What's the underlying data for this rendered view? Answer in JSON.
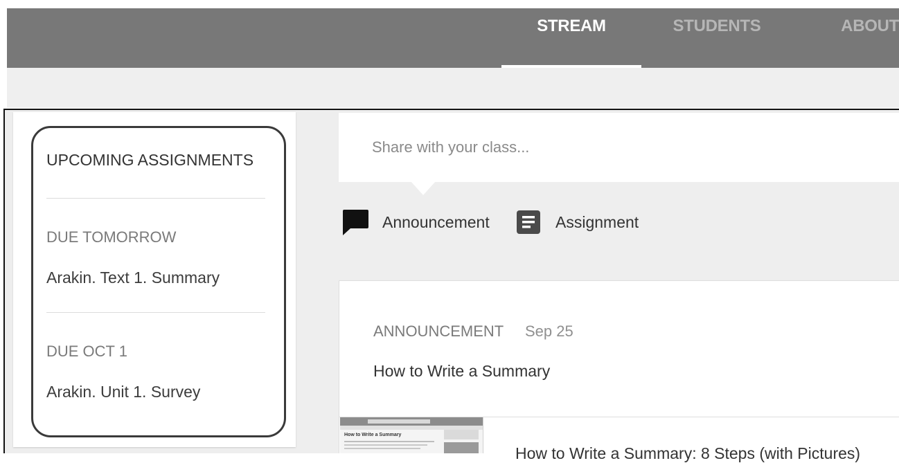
{
  "header": {
    "tabs": [
      {
        "label": "STREAM",
        "active": true
      },
      {
        "label": "STUDENTS",
        "active": false
      },
      {
        "label": "ABOUT",
        "active": false
      }
    ]
  },
  "sidebar": {
    "title": "UPCOMING ASSIGNMENTS",
    "groups": [
      {
        "due": "DUE TOMORROW",
        "item": "Arakin. Text 1. Summary"
      },
      {
        "due": "DUE OCT 1",
        "item": "Arakin. Unit 1. Survey"
      }
    ]
  },
  "composer": {
    "placeholder": "Share with your class...",
    "actions": [
      {
        "label": "Announcement",
        "icon": "chat-bubble-icon"
      },
      {
        "label": "Assignment",
        "icon": "assignment-icon"
      }
    ]
  },
  "post": {
    "type": "ANNOUNCEMENT",
    "date": "Sep 25",
    "title": "How to Write a Summary",
    "attachment": {
      "thumbnail_heading": "How to Write a Summary",
      "link_text": "How to Write a Summary: 8 Steps (with Pictures)"
    }
  },
  "colors": {
    "header_bg": "#787878",
    "active_tab": "#ffffff",
    "inactive_tab": "#b6b6b6",
    "page_bg": "#eeeeee"
  }
}
